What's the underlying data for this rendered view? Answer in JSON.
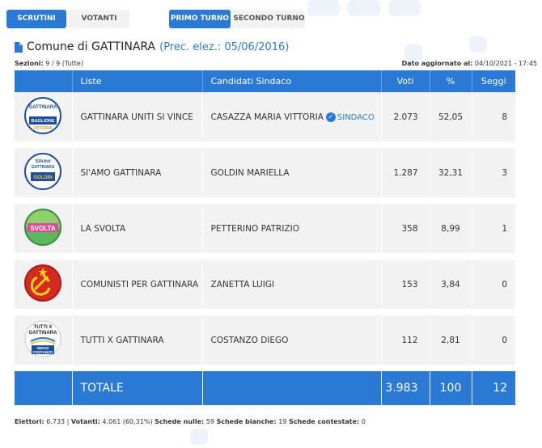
{
  "tabs": {
    "scrutini": "SCRUTINI",
    "votanti": "VOTANTI",
    "primo_turno": "PRIMO TURNO",
    "secondo_turno": "SECONDO TURNO"
  },
  "header": {
    "title": "Comune di GATTINARA",
    "prev_elez": "(Prec. elez.: 05/06/2016)",
    "sezioni_label": "Sezioni:",
    "sezioni_value": "9 / 9 (Tutte)",
    "updated_label": "Dato aggiornato al:",
    "updated_value": "04/10/2021 - 17:45"
  },
  "table": {
    "columns": [
      "",
      "Liste",
      "Candidati Sindaco",
      "Voti",
      "%",
      "Seggi"
    ],
    "rows": [
      {
        "lista": "GATTINARA UNITI SI VINCE",
        "candidato": "CASAZZA MARIA VITTORIA",
        "badge": "SINDACO",
        "voti": "2.073",
        "perc": "52,05",
        "seggi": "8",
        "logo": "gattinara-uniti-logo"
      },
      {
        "lista": "SI'AMO GATTINARA",
        "candidato": "GOLDIN MARIELLA",
        "badge": "",
        "voti": "1.287",
        "perc": "32,31",
        "seggi": "3",
        "logo": "siamo-gattinara-logo"
      },
      {
        "lista": "LA SVOLTA",
        "candidato": "PETTERINO PATRIZIO",
        "badge": "",
        "voti": "358",
        "perc": "8,99",
        "seggi": "1",
        "logo": "la-svolta-logo"
      },
      {
        "lista": "COMUNISTI PER GATTINARA",
        "candidato": "ZANETTA LUIGI",
        "badge": "",
        "voti": "153",
        "perc": "3,84",
        "seggi": "0",
        "logo": "comunisti-logo"
      },
      {
        "lista": "TUTTI X GATTINARA",
        "candidato": "COSTANZO DIEGO",
        "badge": "",
        "voti": "112",
        "perc": "2,81",
        "seggi": "0",
        "logo": "tutti-x-gattinara-logo"
      }
    ],
    "total": {
      "label": "TOTALE",
      "voti": "3.983",
      "perc": "100",
      "seggi": "12"
    }
  },
  "logos": {
    "gattinara_uniti": {
      "line1": "GATTINARA",
      "line2": "BAGLIONE",
      "line3": "VITTORIA"
    },
    "siamo": {
      "line1": "SIAmo",
      "line2": "GATTINARA",
      "line3": "GOLDIN"
    },
    "svolta": {
      "line1": "SVOLTA"
    },
    "tutti": {
      "line1": "TUTTI X",
      "line2": "GATTINARA",
      "line3": "DIEGO",
      "line4": "COSTANZO"
    }
  },
  "footer": {
    "elettori_label": "Elettori:",
    "elettori_value": "6.733",
    "votanti_label": "Votanti:",
    "votanti_value": "4.061 (60,31%)",
    "nulle_label": "Schede nulle:",
    "nulle_value": "59",
    "bianche_label": "Schede bianche:",
    "bianche_value": "19",
    "contestate_label": "Schede contestate:",
    "contestate_value": "0"
  },
  "colors": {
    "accent": "#2a7ad5",
    "row_bg": "#f2f2f2"
  }
}
